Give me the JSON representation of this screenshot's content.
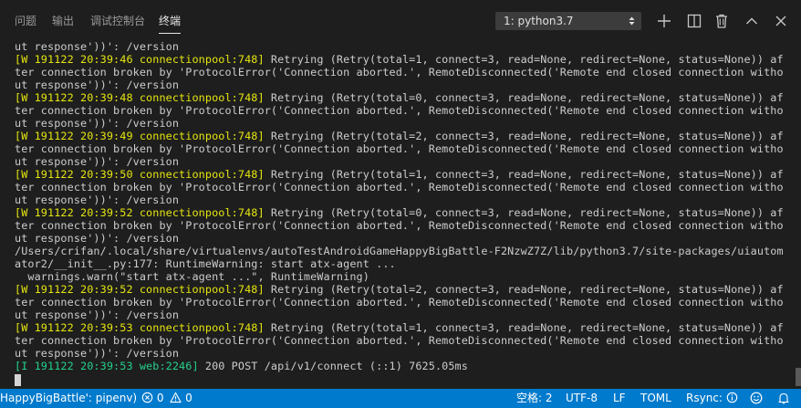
{
  "panel": {
    "tabs": [
      {
        "label": "问题"
      },
      {
        "label": "输出"
      },
      {
        "label": "调试控制台"
      },
      {
        "label": "终端"
      }
    ],
    "terminal_selector": "1: python3.7",
    "icons": {
      "new_terminal": "plus-icon",
      "split": "split-icon",
      "kill": "trash-icon",
      "maximize": "chevron-up-icon",
      "close": "close-icon"
    }
  },
  "terminal": {
    "lines": [
      {
        "text": "ut response'))': /version",
        "kind": "plain"
      },
      {
        "text": "[W 191122 20:39:46 connectionpool:748]",
        "rest": " Retrying (Retry(total=1, connect=3, read=None, redirect=None, status=None)) af",
        "kind": "warn"
      },
      {
        "text": "ter connection broken by 'ProtocolError('Connection aborted.', RemoteDisconnected('Remote end closed connection witho",
        "kind": "plain"
      },
      {
        "text": "ut response'))': /version",
        "kind": "plain"
      },
      {
        "text": "[W 191122 20:39:48 connectionpool:748]",
        "rest": " Retrying (Retry(total=0, connect=3, read=None, redirect=None, status=None)) af",
        "kind": "warn"
      },
      {
        "text": "ter connection broken by 'ProtocolError('Connection aborted.', RemoteDisconnected('Remote end closed connection witho",
        "kind": "plain"
      },
      {
        "text": "ut response'))': /version",
        "kind": "plain"
      },
      {
        "text": "[W 191122 20:39:49 connectionpool:748]",
        "rest": " Retrying (Retry(total=2, connect=3, read=None, redirect=None, status=None)) af",
        "kind": "warn"
      },
      {
        "text": "ter connection broken by 'ProtocolError('Connection aborted.', RemoteDisconnected('Remote end closed connection witho",
        "kind": "plain"
      },
      {
        "text": "ut response'))': /version",
        "kind": "plain"
      },
      {
        "text": "[W 191122 20:39:50 connectionpool:748]",
        "rest": " Retrying (Retry(total=1, connect=3, read=None, redirect=None, status=None)) af",
        "kind": "warn"
      },
      {
        "text": "ter connection broken by 'ProtocolError('Connection aborted.', RemoteDisconnected('Remote end closed connection witho",
        "kind": "plain"
      },
      {
        "text": "ut response'))': /version",
        "kind": "plain"
      },
      {
        "text": "[W 191122 20:39:52 connectionpool:748]",
        "rest": " Retrying (Retry(total=0, connect=3, read=None, redirect=None, status=None)) af",
        "kind": "warn"
      },
      {
        "text": "ter connection broken by 'ProtocolError('Connection aborted.', RemoteDisconnected('Remote end closed connection witho",
        "kind": "plain"
      },
      {
        "text": "ut response'))': /version",
        "kind": "plain"
      },
      {
        "text": "/Users/crifan/.local/share/virtualenvs/autoTestAndroidGameHappyBigBattle-F2NzwZ7Z/lib/python3.7/site-packages/uiautom",
        "kind": "plain"
      },
      {
        "text": "ator2/__init__.py:177: RuntimeWarning: start atx-agent ...",
        "kind": "plain"
      },
      {
        "text": "  warnings.warn(\"start atx-agent ...\", RuntimeWarning)",
        "kind": "plain"
      },
      {
        "text": "[W 191122 20:39:52 connectionpool:748]",
        "rest": " Retrying (Retry(total=2, connect=3, read=None, redirect=None, status=None)) af",
        "kind": "warn"
      },
      {
        "text": "ter connection broken by 'ProtocolError('Connection aborted.', RemoteDisconnected('Remote end closed connection witho",
        "kind": "plain"
      },
      {
        "text": "ut response'))': /version",
        "kind": "plain"
      },
      {
        "text": "[W 191122 20:39:53 connectionpool:748]",
        "rest": " Retrying (Retry(total=1, connect=3, read=None, redirect=None, status=None)) af",
        "kind": "warn"
      },
      {
        "text": "ter connection broken by 'ProtocolError('Connection aborted.', RemoteDisconnected('Remote end closed connection witho",
        "kind": "plain"
      },
      {
        "text": "ut response'))': /version",
        "kind": "plain"
      },
      {
        "text": "[I 191122 20:39:53 web:2246]",
        "rest": " 200 POST /api/v1/connect (::1) 7625.05ms",
        "kind": "info"
      }
    ]
  },
  "statusbar": {
    "interpreter": "HappyBigBattle': pipenv)",
    "errors": "0",
    "warnings": "0",
    "indent": "空格: 2",
    "encoding": "UTF-8",
    "eol": "LF",
    "language": "TOML",
    "rsync": "Rsync:",
    "icons": [
      "error-icon",
      "warning-icon",
      "info-icon",
      "smiley-icon",
      "bell-icon"
    ]
  },
  "colors": {
    "background": "#1e1e1e",
    "warn": "#e5e510",
    "info": "#23d18b",
    "text": "#cccccc",
    "statusbar": "#007acc"
  }
}
